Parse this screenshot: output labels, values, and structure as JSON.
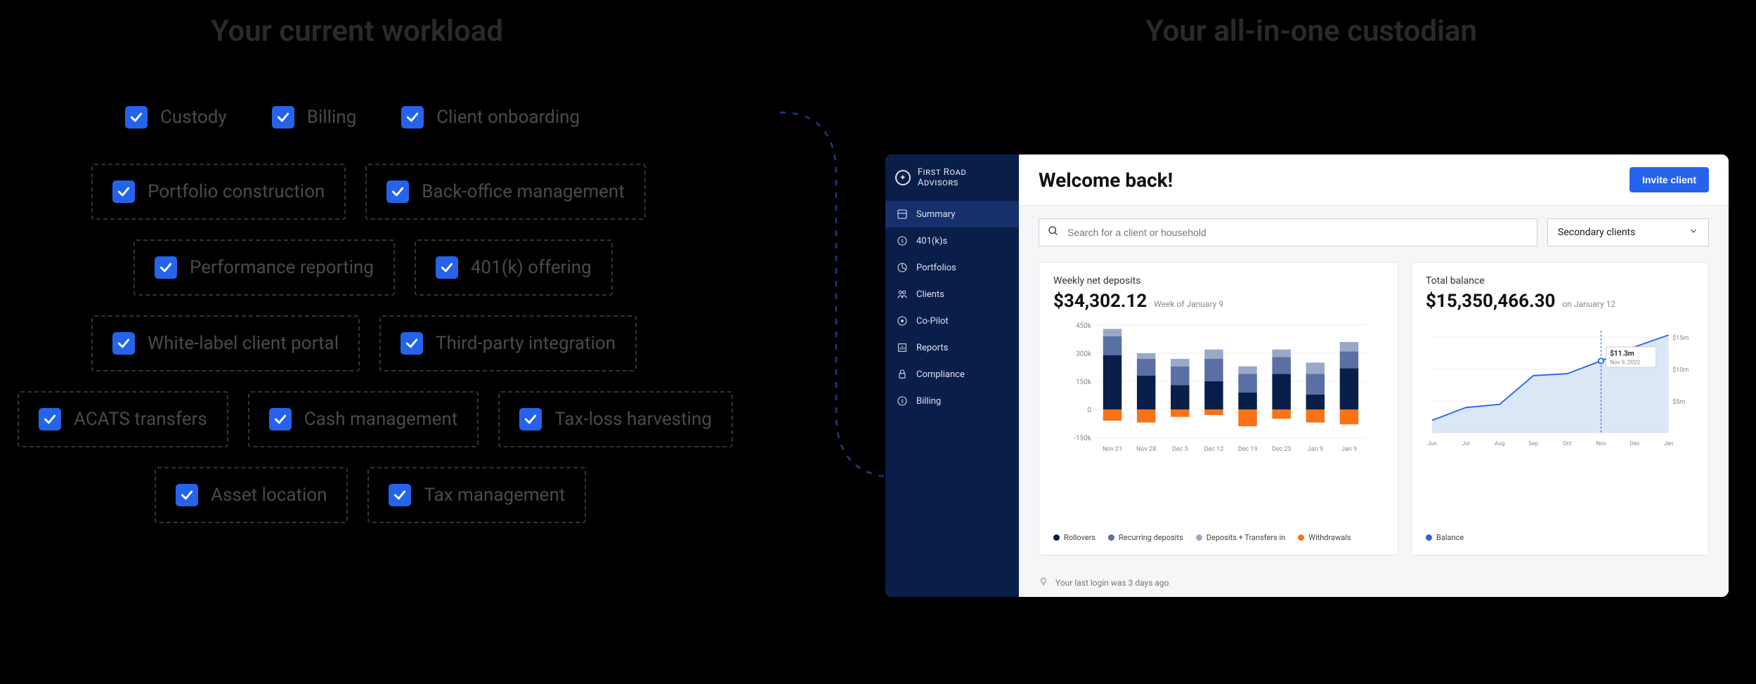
{
  "left": {
    "heading": "Your current workload",
    "tags": [
      [
        {
          "label": "Custody",
          "border": false
        },
        {
          "label": "Billing",
          "border": false
        },
        {
          "label": "Client onboarding",
          "border": false
        }
      ],
      [
        {
          "label": "Portfolio construction",
          "border": true
        },
        {
          "label": "Back-office management",
          "border": true
        }
      ],
      [
        {
          "label": "Performance reporting",
          "border": true
        },
        {
          "label": "401(k) offering",
          "border": true
        }
      ],
      [
        {
          "label": "White-label client portal",
          "border": true
        },
        {
          "label": "Third-party integration",
          "border": true
        }
      ],
      [
        {
          "label": "ACATS transfers",
          "border": true
        },
        {
          "label": "Cash management",
          "border": true
        },
        {
          "label": "Tax-loss harvesting",
          "border": true
        }
      ],
      [
        {
          "label": "Asset location",
          "border": true
        },
        {
          "label": "Tax management",
          "border": true
        }
      ]
    ]
  },
  "right": {
    "heading": "Your all-in-one custodian"
  },
  "dashboard": {
    "brand": "First Road Advisors",
    "nav": [
      {
        "icon": "summary",
        "label": "Summary",
        "active": true
      },
      {
        "icon": "401k",
        "label": "401(k)s",
        "active": false
      },
      {
        "icon": "portfolios",
        "label": "Portfolios",
        "active": false
      },
      {
        "icon": "clients",
        "label": "Clients",
        "active": false
      },
      {
        "icon": "copilot",
        "label": "Co-Pilot",
        "active": false
      },
      {
        "icon": "reports",
        "label": "Reports",
        "active": false
      },
      {
        "icon": "compliance",
        "label": "Compliance",
        "active": false
      },
      {
        "icon": "billing",
        "label": "Billing",
        "active": false
      }
    ],
    "welcome": "Welcome back!",
    "invite_label": "Invite client",
    "search": {
      "placeholder": "Search for a client or household"
    },
    "dropdown": {
      "selected": "Secondary clients"
    },
    "deposits": {
      "title": "Weekly net deposits",
      "value": "$34,302.12",
      "sub": "Week of January 9",
      "y_ticks": [
        "450k",
        "300k",
        "150k",
        "0",
        "-150k"
      ],
      "legend": [
        {
          "color": "#0a1e4a",
          "label": "Rollovers"
        },
        {
          "color": "#5a6fa3",
          "label": "Recurring deposits"
        },
        {
          "color": "#9aa8c8",
          "label": "Deposits + Transfers in"
        },
        {
          "color": "#f97316",
          "label": "Withdrawals"
        }
      ]
    },
    "balance": {
      "title": "Total balance",
      "value": "$15,350,466.30",
      "sub": "on January 12",
      "y_ticks": [
        "$15m",
        "$10m",
        "$5m"
      ],
      "tooltip": {
        "value": "$11.3m",
        "date": "Nov 9, 2022"
      },
      "legend": [
        {
          "color": "#2563eb",
          "label": "Balance"
        }
      ]
    },
    "footer": "Your last login was 3 days ago"
  },
  "chart_data": [
    {
      "type": "bar",
      "title": "Weekly net deposits",
      "stacked": true,
      "categories": [
        "Nov 21",
        "Nov 28",
        "Dec 5",
        "Dec 12",
        "Dec 19",
        "Dec 25",
        "Jan 9",
        "Jan 9"
      ],
      "ylabel": "",
      "ylim": [
        -150000,
        450000
      ],
      "series": [
        {
          "name": "Rollovers",
          "color": "#0a1e4a",
          "values": [
            290000,
            180000,
            130000,
            150000,
            90000,
            190000,
            80000,
            220000
          ]
        },
        {
          "name": "Recurring deposits",
          "color": "#5a6fa3",
          "values": [
            100000,
            90000,
            100000,
            120000,
            100000,
            90000,
            110000,
            90000
          ]
        },
        {
          "name": "Deposits + Transfers in",
          "color": "#9aa8c8",
          "values": [
            40000,
            30000,
            40000,
            50000,
            40000,
            40000,
            60000,
            50000
          ]
        },
        {
          "name": "Withdrawals",
          "color": "#f97316",
          "values": [
            -60000,
            -70000,
            -40000,
            -30000,
            -90000,
            -50000,
            -70000,
            -80000
          ]
        }
      ]
    },
    {
      "type": "line",
      "title": "Total balance",
      "x": [
        "Jun",
        "Jul",
        "Aug",
        "Sep",
        "Oct",
        "Nov",
        "Dec",
        "Jan"
      ],
      "ylabel": "",
      "ylim": [
        0,
        16000000
      ],
      "y_ticks": [
        5000000,
        10000000,
        15000000
      ],
      "series": [
        {
          "name": "Balance",
          "color": "#2563eb",
          "values": [
            2000000,
            4000000,
            4500000,
            9000000,
            9300000,
            11300000,
            13500000,
            15350466
          ]
        }
      ],
      "annotation": {
        "x": "Nov",
        "y": 11300000,
        "label": "$11.3m",
        "date": "Nov 9, 2022"
      }
    }
  ]
}
